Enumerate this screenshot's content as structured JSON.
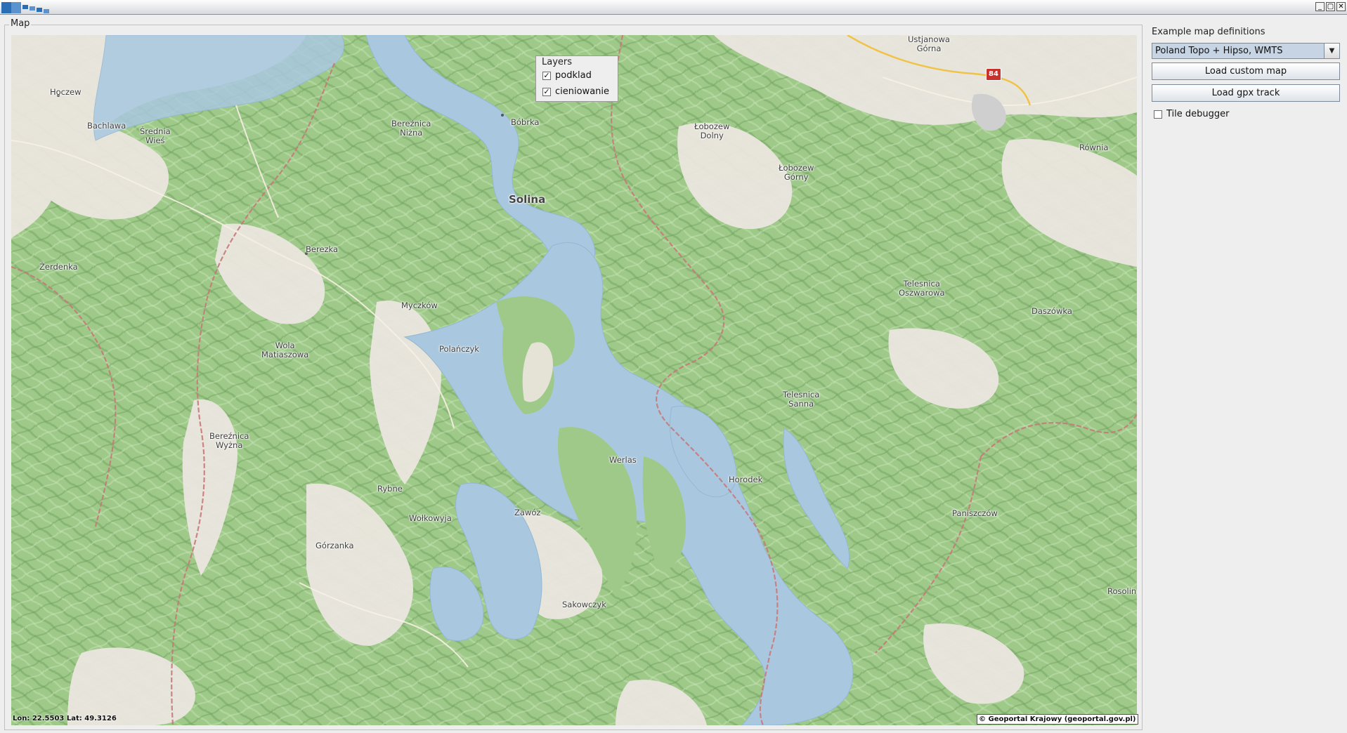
{
  "window": {
    "buttons": {
      "minimize": "_",
      "maximize": "▢",
      "close": "✕"
    }
  },
  "map": {
    "group_label": "Map",
    "layers": {
      "title": "Layers",
      "items": [
        {
          "label": "podklad",
          "checked": true
        },
        {
          "label": "cieniowanie",
          "checked": true
        }
      ]
    },
    "places": {
      "hoczew": "Hoczew",
      "bachlawa": "Bachlawa",
      "srednia_wies": "Średnia\nWieś",
      "bereznica_nizna": "Bereźnica\nNiżna",
      "bobrka": "Bóbrka",
      "lobozew_dolny": "Łobozew\nDolny",
      "lobozew_gorny": "Łobozew\nGórny",
      "ustjanowa_gorna": "Ustjanowa\nGórna",
      "rownia": "Równia",
      "solina": "Solina",
      "berezka": "Berezka",
      "zerdenka": "Żerdenka",
      "myczkow": "Myczków",
      "telesnica_oszwarowa": "Telesnica\nOszwarowa",
      "daszowka": "Daszówka",
      "wola_matiaszowa": "Wola\nMatiaszowa",
      "polanczyk": "Polańczyk",
      "telesnica_sanna": "Telesnica\nSanna",
      "bereznica_wyzna": "Bereźnica\nWyżna",
      "werlas": "Werlas",
      "horodek": "Horodek",
      "rybne": "Rybne",
      "wolkowyja": "Wołkowyja",
      "zawoz": "Zawóz",
      "paniszczow": "Paniszczów",
      "gorzanka": "Górzanka",
      "sakowczyk": "Sakowczyk",
      "rosolin": "Rosolin"
    },
    "road_number": "84",
    "coords_text": "Lon: 22.5503 Lat: 49.3126",
    "attribution": "© Geoportal Krajowy (geoportal.gov.pl)",
    "colors": {
      "water": "#a9c8e0",
      "forest": "#9ec989",
      "open": "#ebe6df",
      "border": "#c8797a"
    }
  },
  "sidebar": {
    "title": "Example map definitions",
    "selected_map": "Poland Topo + Hipso, WMTS",
    "load_custom_label": "Load custom map",
    "load_gpx_label": "Load gpx track",
    "tile_debugger_label": "Tile debugger",
    "tile_debugger_checked": false
  }
}
